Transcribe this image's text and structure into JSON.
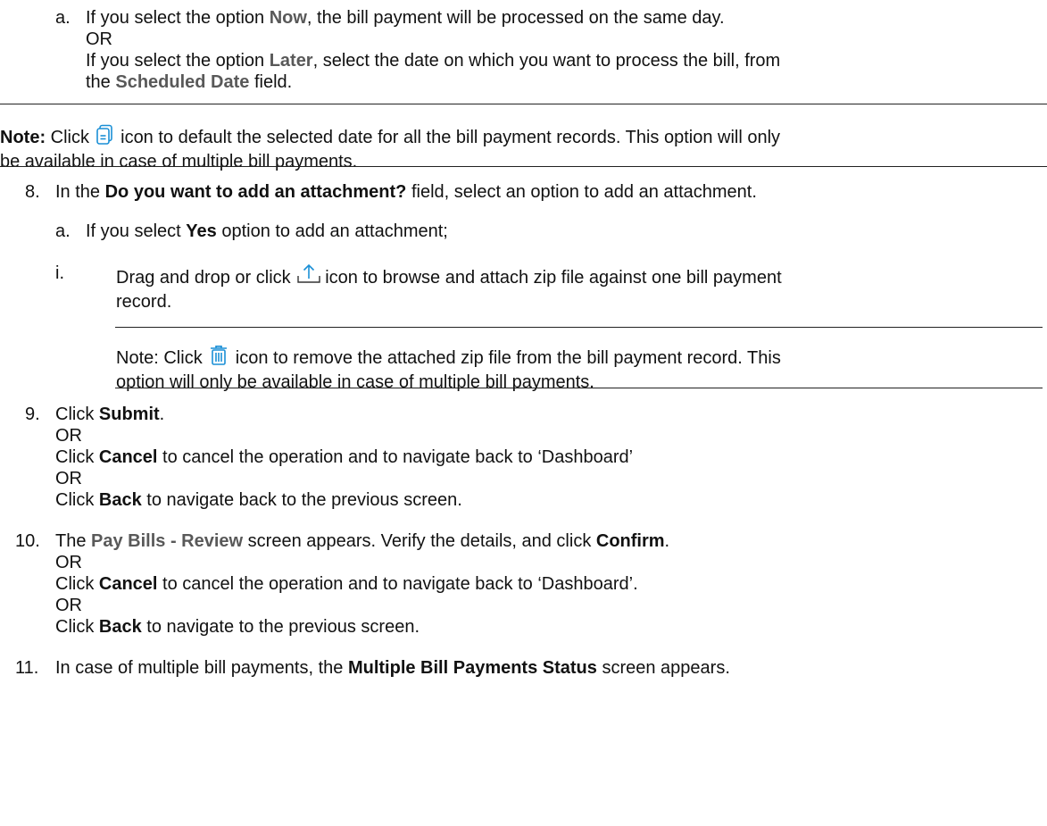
{
  "step7a": {
    "marker": "a.",
    "l1": [
      "If you select the option ",
      "Now",
      ", the bill payment will be processed on the same day."
    ],
    "or": "OR",
    "l3": [
      "If you select the option ",
      "Later",
      ", select the date on which you want to process the bill, from"
    ],
    "l4": [
      "the ",
      "Scheduled Date",
      " field."
    ]
  },
  "note1": {
    "label": "Note:",
    "pre": " Click ",
    "post": " icon to default the selected date for all the bill payment records. This option will only",
    "line2": "be available in case of multiple bill payments."
  },
  "step8": {
    "marker": "8.",
    "pre": "In the ",
    "bold": "Do you want to add an attachment?",
    "post": " field, select an option to add an attachment."
  },
  "step8a": {
    "marker": "a.",
    "pre": "If you select ",
    "bold": "Yes",
    "post": " option to add an attachment;"
  },
  "step8ai": {
    "marker": "i.",
    "pre": "Drag and drop or click ",
    "post": "icon to browse and attach zip file against one bill payment",
    "line2": "record."
  },
  "note2": {
    "pre": "Note: Click ",
    "post": " icon to remove the attached zip file from the bill payment record. This",
    "line2": "option will only be available in case of multiple bill payments."
  },
  "step9": {
    "marker": "9.",
    "l1": [
      "Click ",
      "Submit",
      "."
    ],
    "or": "OR",
    "l3": [
      "Click ",
      "Cancel",
      " to cancel the operation and to navigate back to ‘Dashboard’"
    ],
    "l5": [
      "Click ",
      "Back",
      " to navigate back to the previous screen."
    ]
  },
  "step10": {
    "marker": "10.",
    "l1": [
      "The ",
      "Pay Bills - Review",
      " screen appears. Verify the details, and click ",
      "Confirm",
      "."
    ],
    "or": "OR",
    "l3": [
      "Click ",
      "Cancel",
      " to cancel the operation and to navigate back to ‘Dashboard’."
    ],
    "l5": [
      "Click ",
      "Back",
      " to navigate to the previous screen."
    ]
  },
  "step11": {
    "marker": "11.",
    "pre": "In case of multiple bill payments, the ",
    "bold": "Multiple Bill Payments Status",
    "post": " screen appears."
  },
  "icons": {
    "note1": "copy-date-icon",
    "upload": "upload-icon",
    "delete": "trash-icon",
    "accent": "#1a8fd6"
  }
}
